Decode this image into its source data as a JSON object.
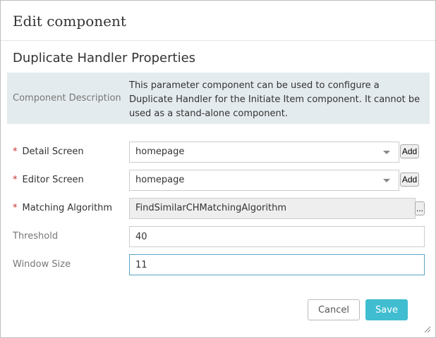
{
  "dialog": {
    "title": "Edit component",
    "section_title": "Duplicate Handler Properties",
    "description": {
      "label": "Component Description",
      "text": "This parameter component can be used to configure a Duplicate Handler for the Initiate Item component. It cannot be used as a stand-alone component."
    }
  },
  "fields": {
    "detail_screen": {
      "required_mark": "*",
      "label": "Detail Screen",
      "value": "homepage",
      "add_label": "Add"
    },
    "editor_screen": {
      "required_mark": "*",
      "label": "Editor Screen",
      "value": "homepage",
      "add_label": "Add"
    },
    "matching_algorithm": {
      "required_mark": "*",
      "label": "Matching Algorithm",
      "value": "FindSimilarCHMatchingAlgorithm",
      "browse_label": "..."
    },
    "threshold": {
      "label": "Threshold",
      "value": "40"
    },
    "window_size": {
      "label": "Window Size",
      "value": "11"
    }
  },
  "footer": {
    "cancel_label": "Cancel",
    "save_label": "Save"
  },
  "colors": {
    "accent": "#40bdd0",
    "required": "#c9302c",
    "description_bg": "#e4ebee"
  }
}
